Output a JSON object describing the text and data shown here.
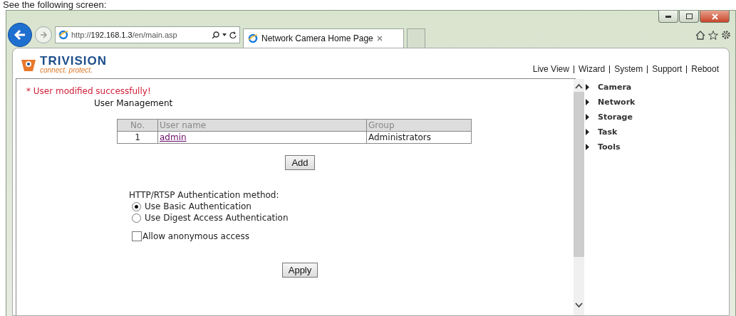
{
  "caption": "See the following screen:",
  "browser": {
    "url": "http://**192.168.1.3**/en/main.asp",
    "tab_title": "Network Camera Home Page"
  },
  "logo": {
    "name": "TRIVISION",
    "tagline": "connect. protect."
  },
  "nav": [
    "Live View",
    "Wizard",
    "System",
    "Support",
    "Reboot"
  ],
  "message": "* User modified successfully!",
  "section_title": "User Management",
  "table": {
    "columns": [
      "No.",
      "User name",
      "Group"
    ],
    "rows": [
      [
        "1",
        "admin",
        "Administrators"
      ]
    ]
  },
  "add_button": "Add",
  "auth": {
    "label": "HTTP/RTSP Authentication method:",
    "options": [
      {
        "label": "Use Basic Authentication",
        "selected": true
      },
      {
        "label": "Use Digest Access Authentication",
        "selected": false
      }
    ]
  },
  "anonymous": {
    "label": "Allow anonymous access",
    "checked": false
  },
  "apply_button": "Apply",
  "sidebar": {
    "items": [
      "Camera",
      "Network",
      "Storage",
      "Task",
      "Tools"
    ]
  }
}
